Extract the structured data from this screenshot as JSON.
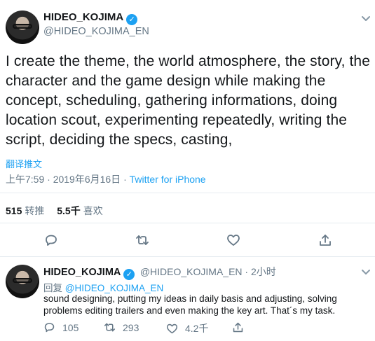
{
  "main_tweet": {
    "author_name": "HIDEO_KOJIMA",
    "author_handle": "@HIDEO_KOJIMA_EN",
    "verified_icon": "✓",
    "text": "I create the theme, the world atmosphere, the story, the character and the game design while making the concept, scheduling, gathering informations, doing location scout, experimenting repeatedly, writing the script, deciding the specs, casting,",
    "translate_label": "翻译推文",
    "timestamp": "上午7:59 · 2019年6月16日",
    "separator": " · ",
    "source": "Twitter for iPhone",
    "retweets_count": "515",
    "retweets_label": "转推",
    "likes_count": "5.5千",
    "likes_label": "喜欢"
  },
  "reply_tweet": {
    "author_name": "HIDEO_KOJIMA",
    "author_handle": "@HIDEO_KOJIMA_EN",
    "time_sep": " · ",
    "time": "2小时",
    "replying_label": "回复",
    "replying_to": "@HIDEO_KOJIMA_EN",
    "text": "sound designing, putting my ideas in daily basis and adjusting, solving problems editing trailers and even making the key art. That´s my task.",
    "reply_count": "105",
    "retweet_count": "293",
    "like_count": "4.2千"
  },
  "icons": {
    "reply": "reply-icon",
    "retweet": "retweet-icon",
    "like": "heart-icon",
    "share": "share-icon",
    "more": "chevron-down-icon",
    "accent": "#1da1f2"
  }
}
